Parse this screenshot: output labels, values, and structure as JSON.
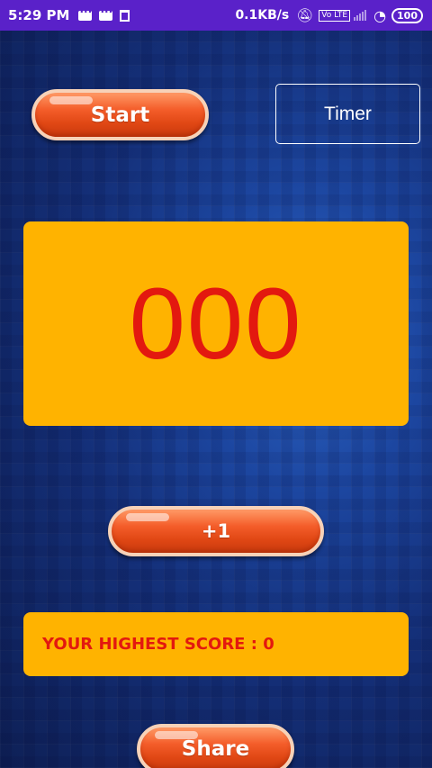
{
  "status_bar": {
    "time": "5:29 PM",
    "net_speed": "0.1KB/s",
    "volte": "Vo LTE",
    "battery": "100",
    "icons": [
      "message-icon",
      "message-icon",
      "trash-icon",
      "bell-mute-icon",
      "volte-icon",
      "signal-icon",
      "wifi-icon",
      "battery-icon"
    ]
  },
  "controls": {
    "start_label": "Start",
    "timer_label": "Timer",
    "plus_label": "+1",
    "share_label": "Share"
  },
  "counter": {
    "value": "000"
  },
  "score": {
    "text": "YOUR HIGHEST SCORE : 0"
  },
  "colors": {
    "status_bar": "#5a21c9",
    "panel": "#ffb300",
    "counter_text": "#e3180f",
    "button": "#f45d2a",
    "background": "#1c46a0"
  }
}
